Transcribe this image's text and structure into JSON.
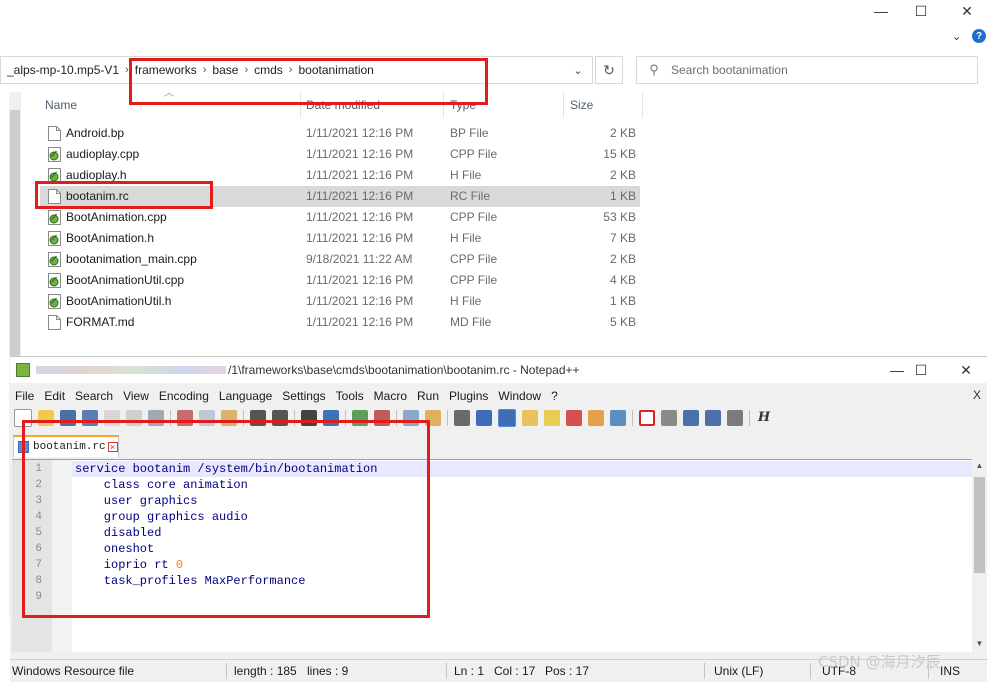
{
  "explorer": {
    "window_controls": [
      "—",
      "☐",
      "✕"
    ],
    "address": {
      "segments": [
        "_alps-mp-10.mp5-V1",
        "frameworks",
        "base",
        "cmds",
        "bootanimation"
      ],
      "separator": "›"
    },
    "search_placeholder": "Search bootanimation",
    "columns": {
      "name": "Name",
      "date": "Date modified",
      "type": "Type",
      "size": "Size"
    },
    "files": [
      {
        "name": "Android.bp",
        "date": "1/11/2021 12:16 PM",
        "type": "BP File",
        "size": "2 KB",
        "icon": "plain-file-icon"
      },
      {
        "name": "audioplay.cpp",
        "date": "1/11/2021 12:16 PM",
        "type": "CPP File",
        "size": "15 KB",
        "icon": "notepadpp-file-icon"
      },
      {
        "name": "audioplay.h",
        "date": "1/11/2021 12:16 PM",
        "type": "H File",
        "size": "2 KB",
        "icon": "notepadpp-file-icon"
      },
      {
        "name": "bootanim.rc",
        "date": "1/11/2021 12:16 PM",
        "type": "RC File",
        "size": "1 KB",
        "icon": "plain-file-icon",
        "selected": true
      },
      {
        "name": "BootAnimation.cpp",
        "date": "1/11/2021 12:16 PM",
        "type": "CPP File",
        "size": "53 KB",
        "icon": "notepadpp-file-icon"
      },
      {
        "name": "BootAnimation.h",
        "date": "1/11/2021 12:16 PM",
        "type": "H File",
        "size": "7 KB",
        "icon": "notepadpp-file-icon"
      },
      {
        "name": "bootanimation_main.cpp",
        "date": "9/18/2021 11:22 AM",
        "type": "CPP File",
        "size": "2 KB",
        "icon": "notepadpp-file-icon"
      },
      {
        "name": "BootAnimationUtil.cpp",
        "date": "1/11/2021 12:16 PM",
        "type": "CPP File",
        "size": "4 KB",
        "icon": "notepadpp-file-icon"
      },
      {
        "name": "BootAnimationUtil.h",
        "date": "1/11/2021 12:16 PM",
        "type": "H File",
        "size": "1 KB",
        "icon": "notepadpp-file-icon"
      },
      {
        "name": "FORMAT.md",
        "date": "1/11/2021 12:16 PM",
        "type": "MD File",
        "size": "5 KB",
        "icon": "plain-file-icon"
      }
    ]
  },
  "notepad": {
    "title": "/1\\frameworks\\base\\cmds\\bootanimation\\bootanim.rc - Notepad++",
    "window_controls": [
      "—",
      "☐",
      "✕"
    ],
    "menu": [
      "File",
      "Edit",
      "Search",
      "View",
      "Encoding",
      "Language",
      "Settings",
      "Tools",
      "Macro",
      "Run",
      "Plugins",
      "Window",
      "?"
    ],
    "menu_close": "X",
    "tab_label": "bootanim.rc",
    "lines": [
      {
        "n": "1",
        "text": "service bootanim /system/bin/bootanimation"
      },
      {
        "n": "2",
        "text": "    class core animation"
      },
      {
        "n": "3",
        "text": "    user graphics"
      },
      {
        "n": "4",
        "text": "    group graphics audio"
      },
      {
        "n": "5",
        "text": "    disabled"
      },
      {
        "n": "6",
        "text": "    oneshot"
      },
      {
        "n": "7",
        "text": "    ioprio rt ",
        "num": "0"
      },
      {
        "n": "8",
        "text": "    task_profiles MaxPerformance"
      },
      {
        "n": "9",
        "text": ""
      }
    ],
    "status": {
      "type": "Windows Resource file",
      "length": "length : 185",
      "lines": "lines : 9",
      "ln": "Ln : 1",
      "col": "Col : 17",
      "pos": "Pos : 17",
      "eol": "Unix (LF)",
      "encoding": "UTF-8",
      "mode": "INS"
    }
  },
  "watermark": "CSDN @海月汐辰",
  "colors": {
    "annotation": "#e21b1b",
    "selected_row": "#d9d9d9",
    "code_text": "#000080",
    "number": "#ff8000"
  }
}
